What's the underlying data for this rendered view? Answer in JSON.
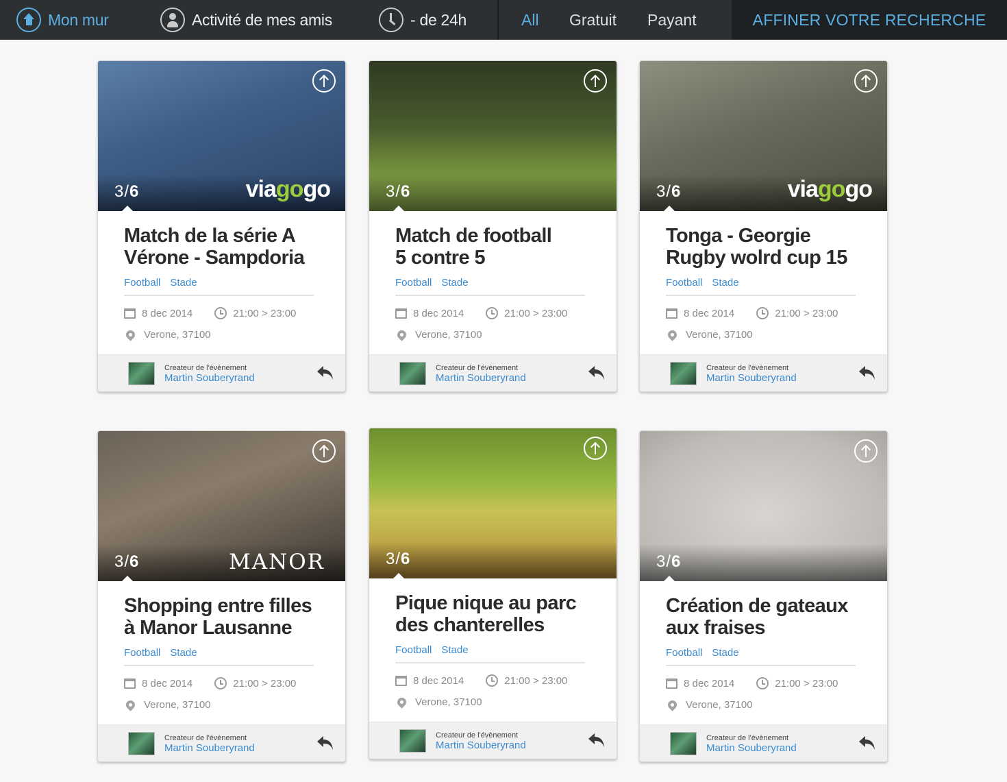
{
  "nav": {
    "items": [
      {
        "label": "Mon mur",
        "icon": "home-icon"
      },
      {
        "label": "Activité de mes amis",
        "icon": "user-icon"
      },
      {
        "label": "- de 24h",
        "icon": "clock-icon"
      }
    ],
    "filters": [
      "All",
      "Gratuit",
      "Payant"
    ],
    "refine_label": "AFFINER VOTRE RECHERCHE"
  },
  "colors": {
    "accent": "#5aaee0",
    "link": "#3a8bd0",
    "nav_bg": "#2d3033"
  },
  "cards": [
    {
      "counter_current": "3",
      "counter_total": "6",
      "brand": "viagogo",
      "title_line1": "Match de la série A",
      "title_line2": "Vérone - Sampdoria",
      "tags": [
        "Football",
        "Stade"
      ],
      "date": "8 dec 2014",
      "time": "21:00 > 23:00",
      "location": "Verone, 37100",
      "creator_label": "Createur de l'évènement",
      "creator_name": "Martin Souberyrand"
    },
    {
      "counter_current": "3",
      "counter_total": "6",
      "brand": "",
      "title_line1": "Match de football",
      "title_line2": "5 contre 5",
      "tags": [
        "Football",
        "Stade"
      ],
      "date": "8 dec 2014",
      "time": "21:00 > 23:00",
      "location": "Verone, 37100",
      "creator_label": "Createur de l'évènement",
      "creator_name": "Martin Souberyrand"
    },
    {
      "counter_current": "3",
      "counter_total": "6",
      "brand": "viagogo",
      "title_line1": "Tonga - Georgie",
      "title_line2": "Rugby wolrd cup 15",
      "tags": [
        "Football",
        "Stade"
      ],
      "date": "8 dec 2014",
      "time": "21:00 > 23:00",
      "location": "Verone, 37100",
      "creator_label": "Createur de l'évènement",
      "creator_name": "Martin Souberyrand"
    },
    {
      "counter_current": "3",
      "counter_total": "6",
      "brand": "MANOR",
      "title_line1": "Shopping entre filles",
      "title_line2": "à Manor Lausanne",
      "tags": [
        "Football",
        "Stade"
      ],
      "date": "8 dec 2014",
      "time": "21:00 > 23:00",
      "location": "Verone, 37100",
      "creator_label": "Createur de l'évènement",
      "creator_name": "Martin Souberyrand"
    },
    {
      "counter_current": "3",
      "counter_total": "6",
      "brand": "",
      "title_line1": "Pique nique au parc",
      "title_line2": "des chanterelles",
      "tags": [
        "Football",
        "Stade"
      ],
      "date": "8 dec 2014",
      "time": "21:00 > 23:00",
      "location": "Verone, 37100",
      "creator_label": "Createur de l'évènement",
      "creator_name": "Martin Souberyrand"
    },
    {
      "counter_current": "3",
      "counter_total": "6",
      "brand": "",
      "title_line1": "Création de gateaux",
      "title_line2": "aux fraises",
      "tags": [
        "Football",
        "Stade"
      ],
      "date": "8 dec 2014",
      "time": "21:00 > 23:00",
      "location": "Verone, 37100",
      "creator_label": "Createur de l'évènement",
      "creator_name": "Martin Souberyrand"
    }
  ]
}
